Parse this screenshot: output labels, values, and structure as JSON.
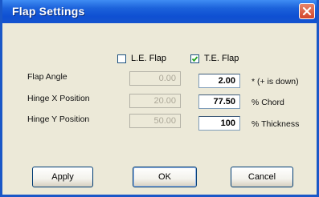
{
  "window": {
    "title": "Flap Settings"
  },
  "checkboxes": {
    "le": {
      "label": "L.E. Flap",
      "checked": false
    },
    "te": {
      "label": "T.E. Flap",
      "checked": true
    }
  },
  "rows": [
    {
      "label": "Flap Angle",
      "le_value": "0.00",
      "te_value": "2.00",
      "unit": "* (+ is down)"
    },
    {
      "label": "Hinge X Position",
      "le_value": "20.00",
      "te_value": "77.50",
      "unit": "% Chord"
    },
    {
      "label": "Hinge Y Position",
      "le_value": "50.00",
      "te_value": "100",
      "unit": "% Thickness"
    }
  ],
  "buttons": {
    "apply": "Apply",
    "ok": "OK",
    "cancel": "Cancel"
  },
  "icons": {
    "close": "close-icon",
    "check": "checkmark-icon"
  }
}
